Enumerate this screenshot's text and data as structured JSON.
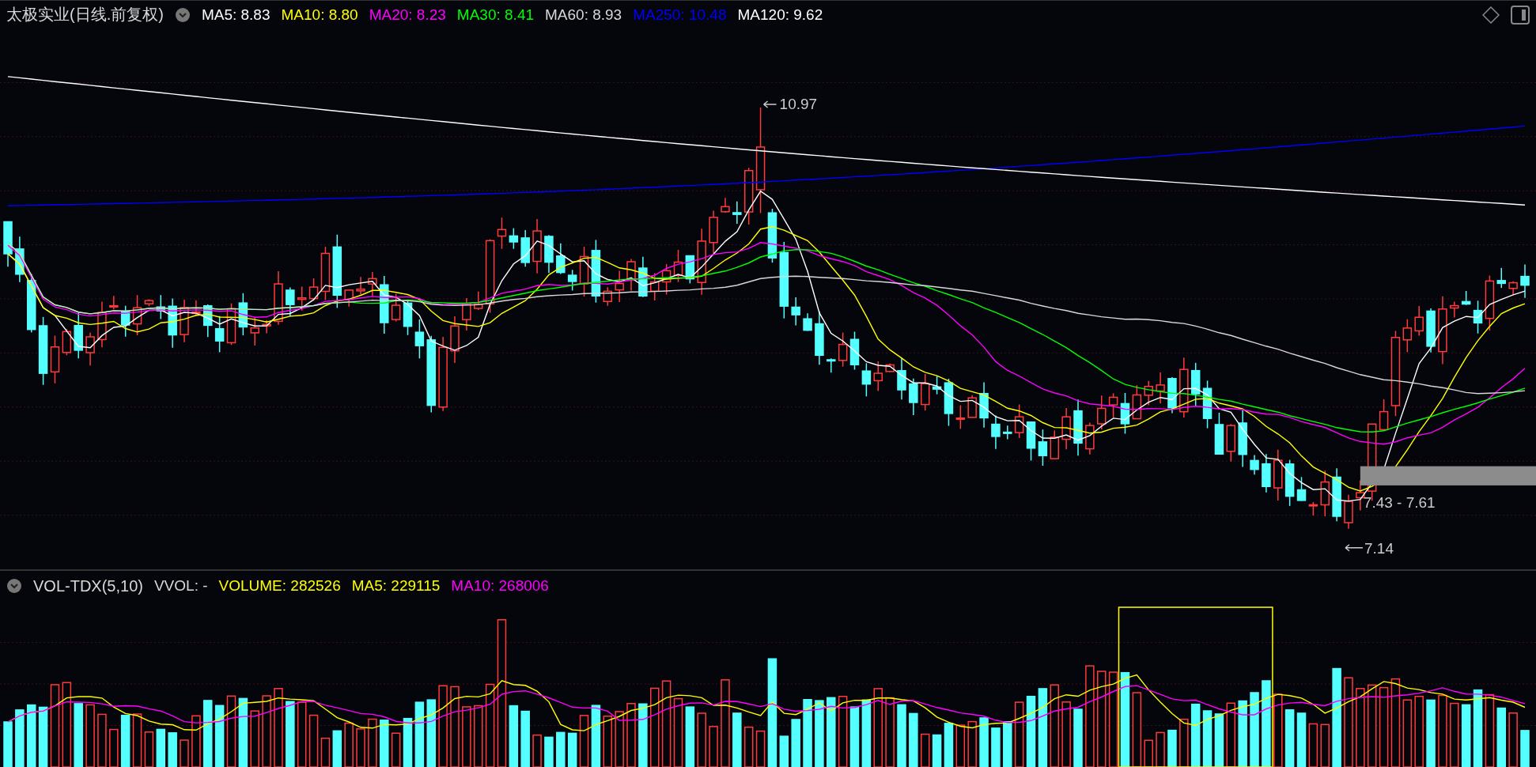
{
  "price_panel": {
    "title": "太极实业(日线.前复权)",
    "indicators": [
      {
        "label": "MA5: 8.83",
        "color": "#ffffff"
      },
      {
        "label": "MA10: 8.80",
        "color": "#ffff00"
      },
      {
        "label": "MA20: 8.23",
        "color": "#ff00ff"
      },
      {
        "label": "MA30: 8.41",
        "color": "#00ff00"
      },
      {
        "label": "MA60: 8.93",
        "color": "#d8d8d8"
      },
      {
        "label": "MA250: 10.48",
        "color": "#0000ff"
      },
      {
        "label": "MA120: 9.62",
        "color": "#ffffff"
      }
    ],
    "annotations": [
      {
        "kind": "high",
        "text": "10.97"
      },
      {
        "kind": "low",
        "text": "7.14"
      },
      {
        "kind": "range",
        "text": "7.43 - 7.61"
      }
    ]
  },
  "volume_panel": {
    "title": "VOL-TDX(5,10)",
    "indicators": [
      {
        "label": "VVOL: -",
        "color": "#d8d8d8"
      },
      {
        "label": "VOLUME: 282526",
        "color": "#ffff00"
      },
      {
        "label": "MA5: 229115",
        "color": "#ffff00"
      },
      {
        "label": "MA10: 268006",
        "color": "#ff00ff"
      }
    ]
  }
}
